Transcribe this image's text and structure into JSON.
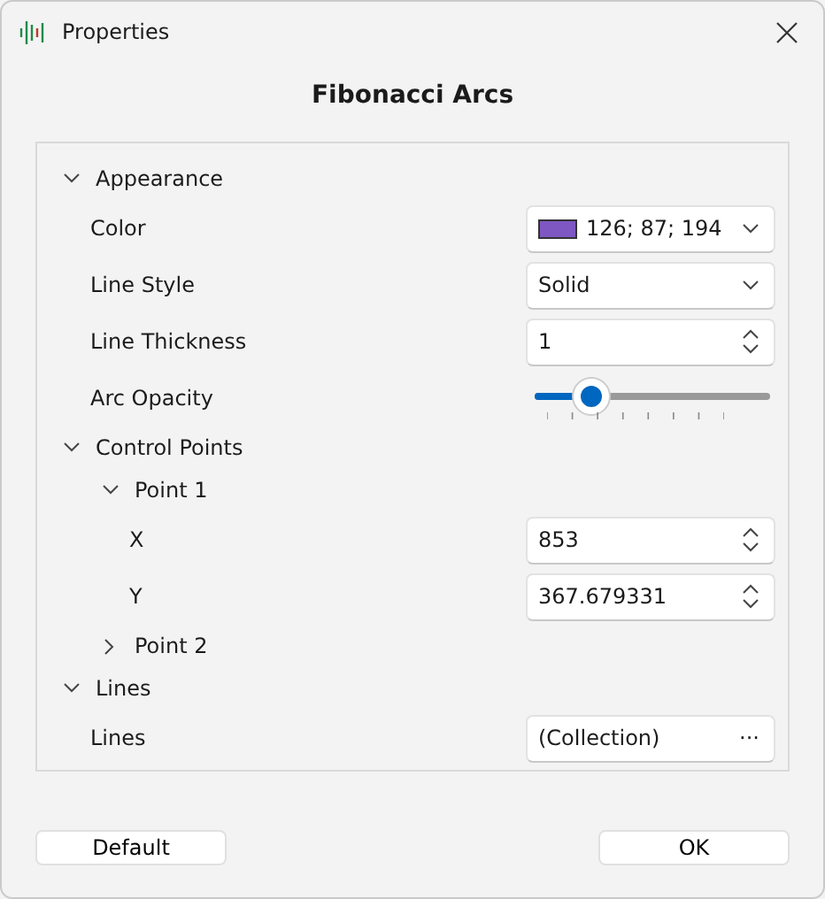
{
  "window": {
    "title": "Properties"
  },
  "heading": "Fibonacci Arcs",
  "properties": [
    {
      "label": "Appearance",
      "expanded": true,
      "children": [
        {
          "label": "Color",
          "kind": "color",
          "value": "126; 87; 194",
          "color": "#7e57c2"
        },
        {
          "label": "Line Style",
          "kind": "dropdown",
          "value": "Solid"
        },
        {
          "label": "Line Thickness",
          "kind": "spin",
          "value": "1"
        },
        {
          "label": "Arc Opacity",
          "kind": "slider",
          "level": 0.24
        }
      ]
    },
    {
      "label": "Control Points",
      "expanded": true,
      "children": [
        {
          "label": "Point 1",
          "expanded": true,
          "children": [
            {
              "label": "X",
              "kind": "spin",
              "value": "853"
            },
            {
              "label": "Y",
              "kind": "spin",
              "value": "367.679331"
            }
          ]
        },
        {
          "label": "Point 2",
          "expanded": false
        }
      ]
    },
    {
      "label": "Lines",
      "expanded": true,
      "children": [
        {
          "label": "Lines",
          "kind": "collection",
          "value": "(Collection)",
          "button": "···"
        }
      ]
    }
  ],
  "buttons": [
    "Default",
    "OK"
  ]
}
